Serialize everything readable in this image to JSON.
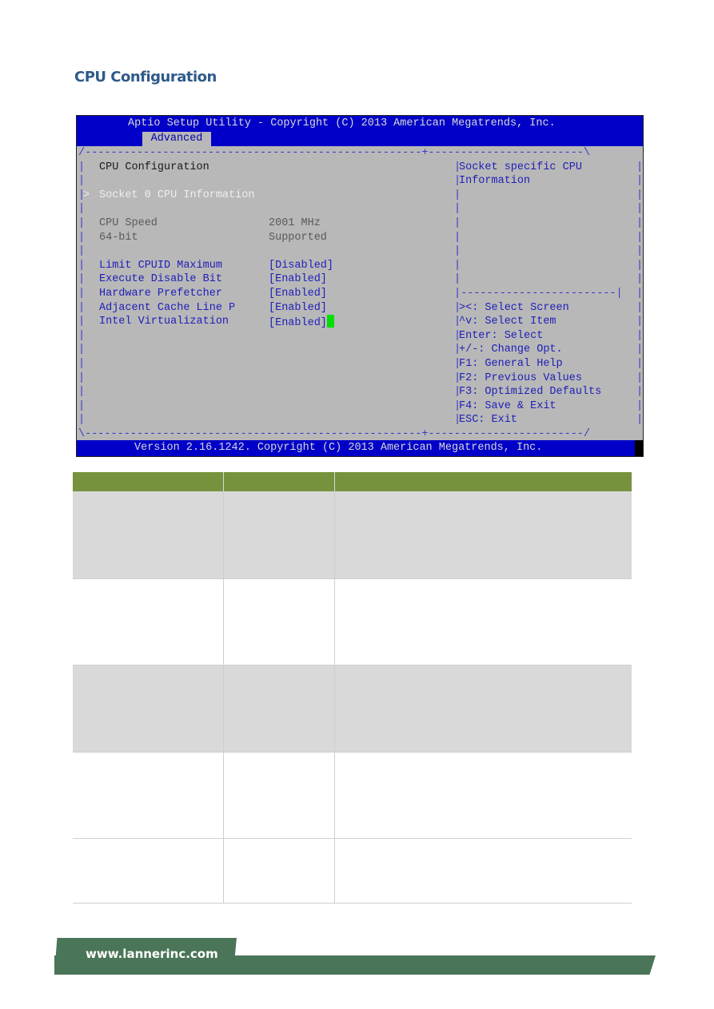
{
  "page": {
    "title": "CPU Configuration"
  },
  "bios": {
    "title": "Aptio Setup Utility - Copyright (C) 2013 American Megatrends, Inc.",
    "active_tab": "Advanced",
    "section_heading": "CPU Configuration",
    "submenu": {
      "label": "Socket 0 CPU Information",
      "arrow": ">"
    },
    "info_rows": [
      {
        "label": "CPU Speed",
        "value": "2001 MHz"
      },
      {
        "label": "64-bit",
        "value": "Supported"
      }
    ],
    "settings": [
      {
        "label": "Limit CPUID Maximum",
        "value": "[Disabled]"
      },
      {
        "label": "Execute Disable Bit",
        "value": "[Enabled]"
      },
      {
        "label": "Hardware Prefetcher",
        "value": "[Enabled]"
      },
      {
        "label": "Adjacent Cache Line P",
        "value": "[Enabled]"
      },
      {
        "label": "Intel Virtualization",
        "value": "[Enabled]"
      }
    ],
    "help_text": [
      "Socket specific CPU",
      "Information"
    ],
    "key_help": [
      "><: Select Screen",
      "^v: Select Item",
      "Enter: Select",
      "+/-: Change Opt.",
      "F1: General Help",
      "F2: Previous Values",
      "F3: Optimized Defaults",
      "F4: Save & Exit",
      "ESC: Exit"
    ],
    "footer": "Version 2.16.1242. Copyright (C) 2013 American Megatrends, Inc.",
    "colors": {
      "header_blue": "#0000c8",
      "body_gray": "#b8b8b8",
      "cursor_green": "#00e000"
    }
  },
  "table": {
    "header_color": "#76923c",
    "headers": [
      "",
      "",
      ""
    ],
    "rows": [
      [
        "",
        "",
        ""
      ],
      [
        "",
        "",
        ""
      ],
      [
        "",
        "",
        ""
      ],
      [
        "",
        "",
        ""
      ],
      [
        "",
        "",
        ""
      ]
    ]
  },
  "footer": {
    "url": "www.lannerinc.com",
    "color": "#4a7558"
  }
}
